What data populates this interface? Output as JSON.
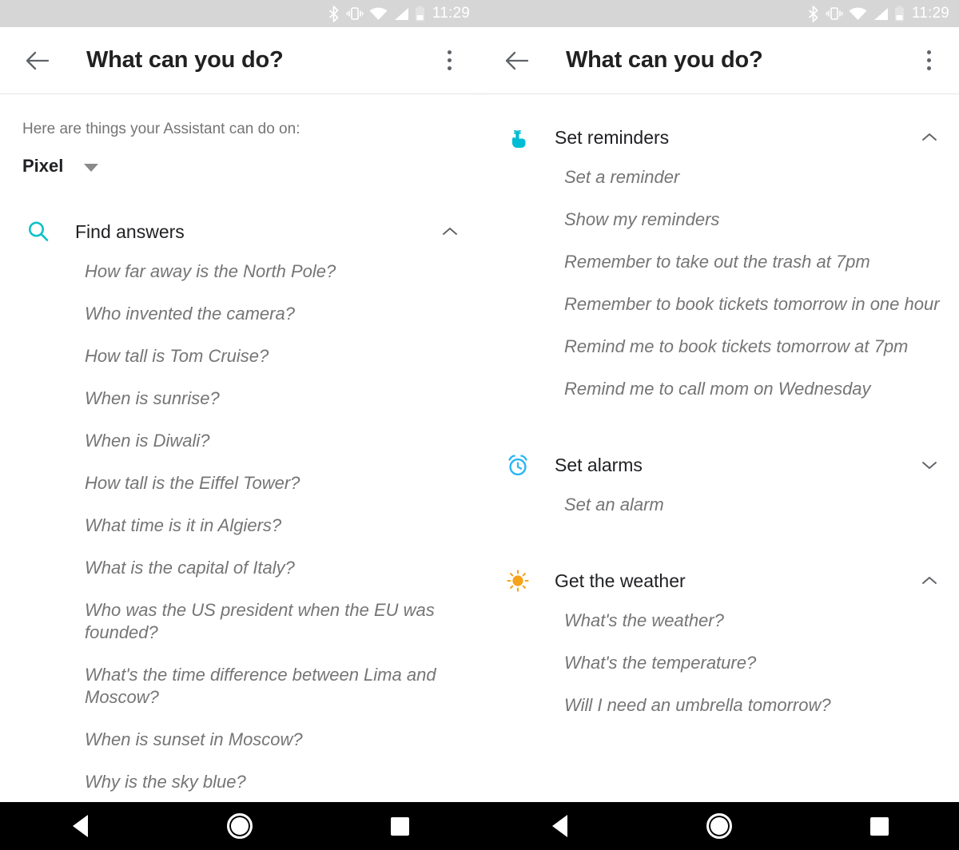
{
  "status_bar": {
    "time": "11:29",
    "icons": [
      "bluetooth-icon",
      "vibrate-icon",
      "wifi-icon",
      "cell-signal-icon",
      "battery-icon"
    ],
    "background_color": "#d6d6d6",
    "icon_color": "#ffffff"
  },
  "app_bar": {
    "back_label": "Back",
    "title": "What can you do?",
    "overflow_label": "More options"
  },
  "left_panel": {
    "intro": "Here are things your Assistant can do on:",
    "device": "Pixel",
    "sections": [
      {
        "icon": "search-icon",
        "icon_color": "#0fc1c6",
        "title": "Find answers",
        "expanded": true,
        "chevron": "chevron-up-icon",
        "items": [
          "How far away is the North Pole?",
          "Who invented the camera?",
          "How tall is Tom Cruise?",
          "When is sunrise?",
          "When is Diwali?",
          "How tall is the Eiffel Tower?",
          "What time is it in Algiers?",
          "What is the capital of Italy?",
          "Who was the US president when the EU was founded?",
          "What's the time difference between Lima and Moscow?",
          "When is sunset in Moscow?",
          "Why is the sky blue?"
        ]
      }
    ]
  },
  "right_panel": {
    "sections": [
      {
        "icon": "reminder-hand-icon",
        "icon_color": "#00bcd4",
        "title": "Set reminders",
        "expanded": true,
        "chevron": "chevron-up-icon",
        "items": [
          "Set a reminder",
          "Show my reminders",
          "Remember to take out the trash at 7pm",
          "Remember to book tickets tomorrow in one hour",
          "Remind me to book tickets tomorrow at 7pm",
          "Remind me to call mom on Wednesday"
        ]
      },
      {
        "icon": "alarm-clock-icon",
        "icon_color": "#29b6f6",
        "title": "Set alarms",
        "expanded": false,
        "chevron": "chevron-down-icon",
        "items": [
          "Set an alarm"
        ]
      },
      {
        "icon": "sun-icon",
        "icon_color": "#f7a21b",
        "title": "Get the weather",
        "expanded": true,
        "chevron": "chevron-up-icon",
        "items": [
          "What's the weather?",
          "What's the temperature?",
          "Will I need an umbrella tomorrow?"
        ]
      }
    ]
  },
  "nav_bar": {
    "back_label": "Back",
    "home_label": "Home",
    "recents_label": "Recents",
    "background_color": "#000000"
  }
}
